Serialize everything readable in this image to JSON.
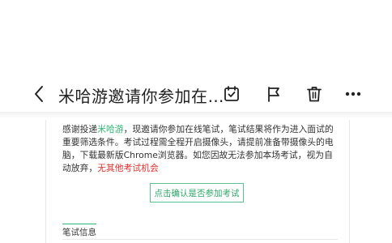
{
  "header": {
    "title": "米哈游邀请你参加在…",
    "actions": [
      "calendar-check-icon",
      "flag-icon",
      "trash-icon",
      "more-icon"
    ]
  },
  "message": {
    "seg1": "感谢投递",
    "company": "米哈游",
    "seg2": "，现邀请你参加在线笔试，笔试结果将作为进入面试的重要筛选条件。考试过程需全程开启摄像头，请提前准备带摄像头的电脑，下载最新版Chrome浏览器。如您因故无法参加本场考试，视为自动放弃，",
    "warning": "无其他考试机会"
  },
  "confirm_button": "点击确认是否参加考试",
  "section": {
    "title": "笔试信息"
  },
  "colors": {
    "accent_green": "#2bb673",
    "warning_red": "#e0302b"
  }
}
